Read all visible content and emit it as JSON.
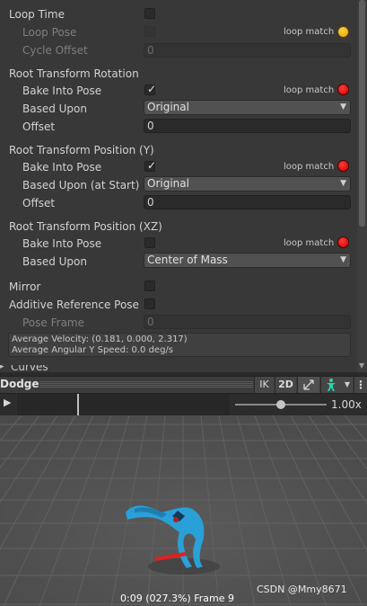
{
  "inspector": {
    "loop_time": "Loop Time",
    "loop_pose": "Loop Pose",
    "loop_match": "loop match",
    "cycle_offset": "Cycle Offset",
    "cycle_offset_value": "0",
    "rot_header": "Root Transform Rotation",
    "bake_into_pose": "Bake Into Pose",
    "based_upon": "Based Upon",
    "rot_based_upon_value": "Original",
    "offset": "Offset",
    "rot_offset_value": "0",
    "posy_header": "Root Transform Position (Y)",
    "based_upon_start": "Based Upon (at Start)",
    "posy_based_upon_value": "Original",
    "posy_offset_value": "0",
    "posxz_header": "Root Transform Position (XZ)",
    "posxz_based_upon_value": "Center of Mass",
    "mirror": "Mirror",
    "additive_reference_pose": "Additive Reference Pose",
    "pose_frame": "Pose Frame",
    "pose_frame_value": "0",
    "info_line1": "Average Velocity: (0.181, 0.000, 2.317)",
    "info_line2": "Average Angular Y Speed: 0.0 deg/s",
    "curves": "Curves"
  },
  "preview": {
    "title": "Dodge",
    "ik": "IK",
    "mode_2d": "2D",
    "speed": "1.00x",
    "status": "0:09 (027.3%) Frame 9",
    "watermark": "CSDN @Mmy8671",
    "timeline_progress": 0.273,
    "speed_slider": 0.5
  },
  "colors": {
    "loop_match_red": "#ff2020",
    "loop_match_yellow": "#f5b800",
    "character_blue": "#2aa0d8",
    "root_motion_red": "#e02020"
  }
}
